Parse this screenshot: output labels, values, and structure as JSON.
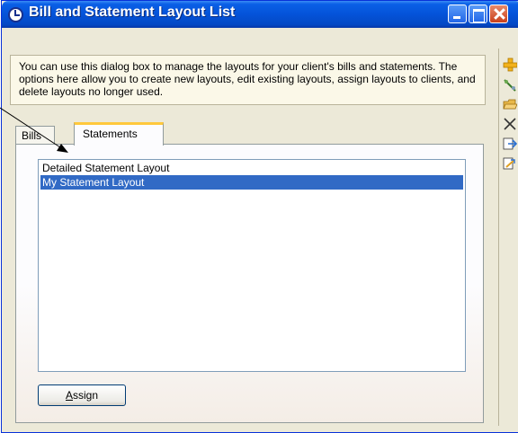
{
  "window": {
    "title": "Bill and Statement Layout List",
    "colors": {
      "titlebar": "#0453d9",
      "selection": "#316ac5",
      "tab_accent": "#ffc83c",
      "desc_bg": "#fbf8e8"
    }
  },
  "description": "You can use this dialog box to manage the layouts for your client's bills and statements. The options here allow you to create new layouts, edit existing layouts, assign layouts to clients, and delete layouts no longer used.",
  "tabs": [
    {
      "label": "Bills",
      "active": false
    },
    {
      "label": "Statements",
      "active": true
    }
  ],
  "list": {
    "items": [
      {
        "label": "Detailed Statement Layout",
        "selected": false
      },
      {
        "label": "My Statement Layout",
        "selected": true
      }
    ]
  },
  "buttons": {
    "assign_mnemonic": "A",
    "assign_rest": "ssign"
  },
  "toolbar_icons": [
    "add-icon",
    "edit-icon",
    "open-folder-icon",
    "delete-icon",
    "copy-layout-icon",
    "assign-layout-icon"
  ]
}
